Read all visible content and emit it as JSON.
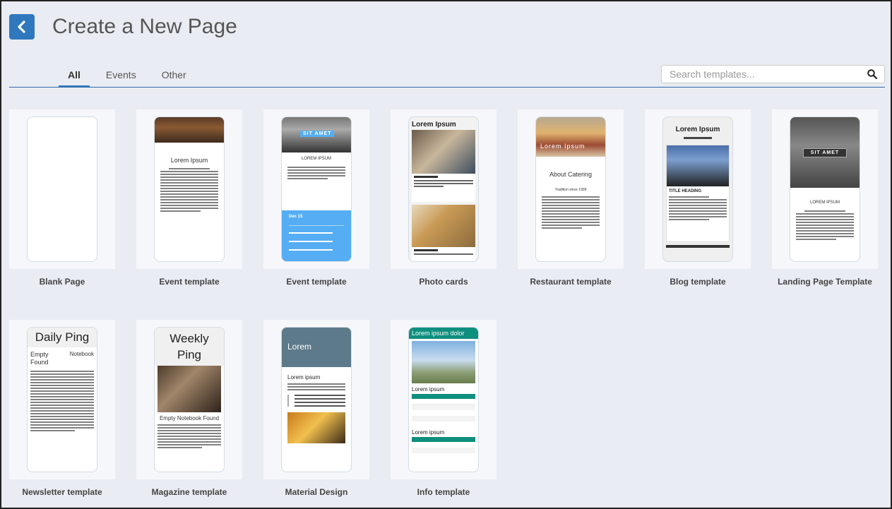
{
  "header": {
    "title": "Create a New Page"
  },
  "tabs": [
    {
      "label": "All",
      "active": true
    },
    {
      "label": "Events",
      "active": false
    },
    {
      "label": "Other",
      "active": false
    }
  ],
  "search": {
    "placeholder": "Search templates...",
    "value": ""
  },
  "templates": [
    {
      "label": "Blank Page"
    },
    {
      "label": "Event template",
      "preview_title": "Lorem Ipsum"
    },
    {
      "label": "Event template",
      "preview_title": "SIT AMET",
      "preview_sub": "LOREM IPSUM",
      "preview_date": "Dec 15"
    },
    {
      "label": "Photo cards",
      "preview_title": "Lorem Ipsum"
    },
    {
      "label": "Restaurant template",
      "preview_title": "Lorem Ipsum",
      "preview_sub": "About Catering",
      "preview_note": "Tradition since 1999"
    },
    {
      "label": "Blog template",
      "preview_title": "Lorem Ipsum",
      "preview_sub": "TITLE HEADING"
    },
    {
      "label": "Landing Page Template",
      "preview_title": "SIT AMET",
      "preview_sub": "LOREM IPSUM"
    },
    {
      "label": "Newsletter template",
      "preview_title": "Daily Ping",
      "preview_left": "Empty Found",
      "preview_right": "Notebook"
    },
    {
      "label": "Magazine template",
      "preview_title": "Weekly Ping",
      "preview_sub": "Empty Notebook Found"
    },
    {
      "label": "Material Design",
      "preview_title": "Lorem",
      "preview_sub": "Lorem ipsum"
    },
    {
      "label": "Info template",
      "preview_title": "Lorem ipsum dolor",
      "preview_sub": "Lorem ipsum",
      "preview_sub2": "Lorem ipsum"
    }
  ],
  "colors": {
    "accent": "#2f78bd",
    "teal": "#0f8f7e",
    "material": "#5d7a8a",
    "event_blue": "#55aef3"
  }
}
